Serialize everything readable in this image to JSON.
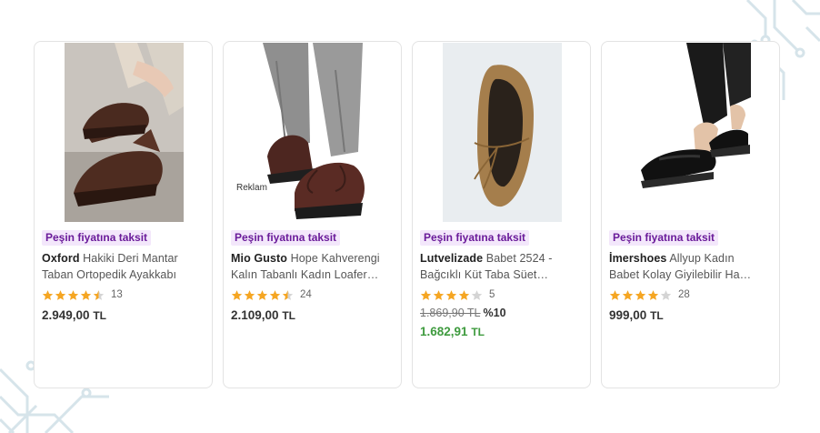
{
  "products": [
    {
      "badge": "Peşin fiyatına taksit",
      "brand": "Oxford",
      "title_rest": " Hakiki Deri Mantar",
      "title_line2": "Taban Ortopedik Ayakkabı",
      "rating": 4.5,
      "review_count": "13",
      "price": "2.949,00",
      "currency": "TL",
      "image_icon": "brown-suede-shoe-image"
    },
    {
      "badge": "Peşin fiyatına taksit",
      "brand": "Mio Gusto",
      "title_rest": " Hope Kahverengi",
      "title_line2": "Kalın Tabanlı Kadın Loafer…",
      "rating": 4.5,
      "review_count": "24",
      "price": "2.109,00",
      "currency": "TL",
      "ad_label": "Reklam",
      "image_icon": "brown-lace-up-shoe-image"
    },
    {
      "badge": "Peşin fiyatına taksit",
      "brand": "Lutvelizade",
      "title_rest": " Babet 2524 -",
      "title_line2": "Bağcıklı Küt Taba Süet…",
      "rating": 4,
      "review_count": "5",
      "old_price": "1.869,90 TL",
      "discount": "%10",
      "price": "1.682,91",
      "currency": "TL",
      "image_icon": "tan-ballet-flat-image"
    },
    {
      "badge": "Peşin fiyatına taksit",
      "brand": "İmershoes",
      "title_rest": " Allyup Kadın",
      "title_line2": "Babet Kolay Giyilebilir Ha…",
      "rating": 4,
      "review_count": "28",
      "price": "999,00",
      "currency": "TL",
      "image_icon": "black-mary-jane-shoe-image"
    }
  ],
  "colors": {
    "badge_bg": "#f3e7fb",
    "badge_text": "#6a1b9a",
    "star": "#f5a623",
    "discounted_price": "#3f9b3f"
  }
}
